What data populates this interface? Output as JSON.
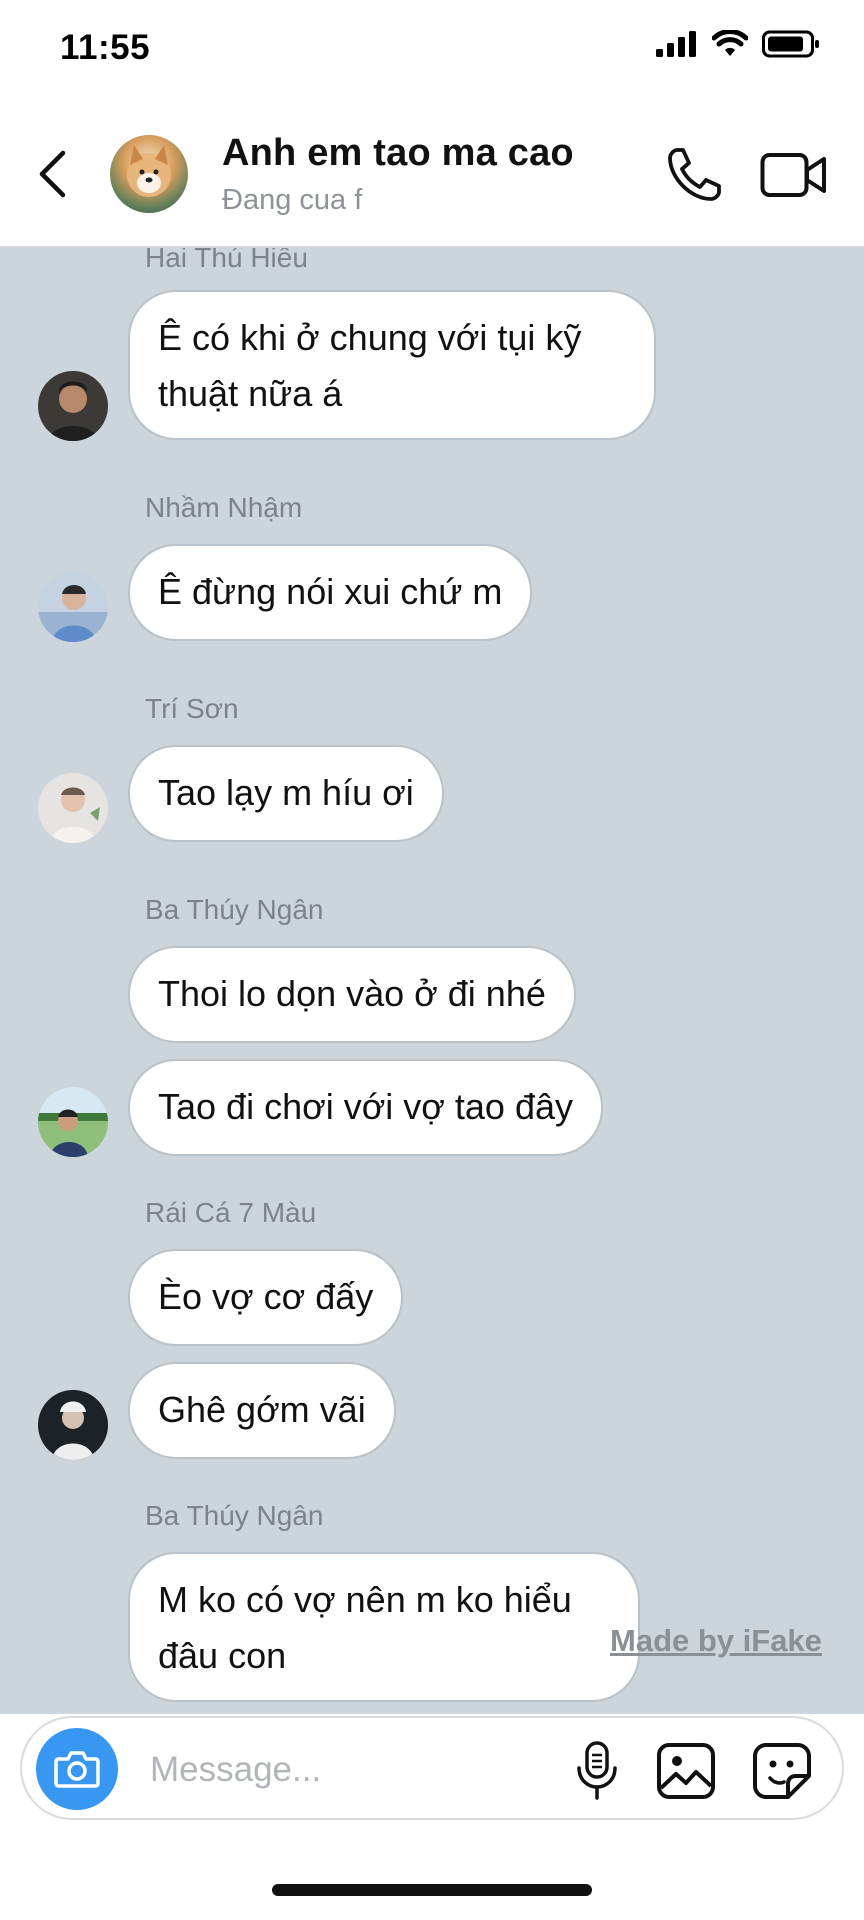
{
  "status_bar": {
    "time": "11:55"
  },
  "header": {
    "title": "Anh em tao ma cao",
    "status": "Đang cua f"
  },
  "messages": [
    {
      "sender": "Hai Thú Hiếu",
      "texts": [
        "Ê có khi ở chung với tụi kỹ thuật nữa á"
      ]
    },
    {
      "sender": "Nhầm Nhậm",
      "texts": [
        "Ê đừng nói xui chứ m"
      ]
    },
    {
      "sender": "Trí Sơn",
      "texts": [
        "Tao lạy m híu ơi"
      ]
    },
    {
      "sender": "Ba Thúy Ngân",
      "texts": [
        "Thoi lo dọn vào ở đi nhé",
        "Tao đi chơi với vợ tao đây"
      ]
    },
    {
      "sender": "Rái Cá 7 Màu",
      "texts": [
        "Èo vợ cơ đấy",
        "Ghê gớm vãi"
      ]
    },
    {
      "sender": "Ba Thúy Ngân",
      "texts": [
        "M ko có vợ nên m ko hiểu đâu con"
      ]
    }
  ],
  "watermark": "Made by iFake",
  "composer": {
    "placeholder": "Message..."
  },
  "icons": {
    "back": "chevron-left-icon",
    "call": "phone-icon",
    "video": "video-camera-icon",
    "camera": "camera-icon",
    "mic": "microphone-icon",
    "gallery": "image-icon",
    "sticker": "sticker-icon"
  },
  "colors": {
    "chat_background": "#ccd5db",
    "camera_button": "#3897f0",
    "bubble": "#ffffff"
  }
}
